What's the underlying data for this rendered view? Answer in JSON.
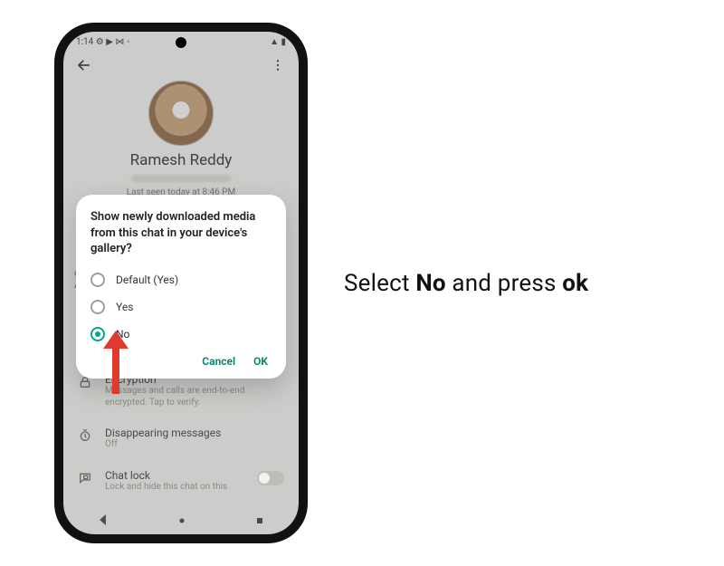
{
  "statusbar": {
    "time": "1:14",
    "icons_left": "⚙ ▶ ⋈ ◦",
    "icons_right": "▲ ▮"
  },
  "profile": {
    "name": "Ramesh Reddy",
    "last_seen": "Last seen today at 8:46 PM"
  },
  "truncated_item": {
    "line1": "do",
    "line2": "Au"
  },
  "dialog": {
    "title": "Show newly downloaded media from this chat in your device's gallery?",
    "options": [
      "Default (Yes)",
      "Yes",
      "No"
    ],
    "selected_index": 2,
    "cancel": "Cancel",
    "ok": "OK"
  },
  "settings": {
    "encryption": {
      "title": "Encryption",
      "sub": "Messages and calls are end-to-end encrypted. Tap to verify."
    },
    "disappearing": {
      "title": "Disappearing messages",
      "sub": "Off"
    },
    "chatlock": {
      "title": "Chat lock",
      "sub": "Lock and hide this chat on this"
    }
  },
  "instruction": {
    "pre": "Select ",
    "bold1": "No",
    "mid": " and press ",
    "bold2": "ok"
  },
  "colors": {
    "accent": "#00a884",
    "arrow": "#e03a2f"
  }
}
